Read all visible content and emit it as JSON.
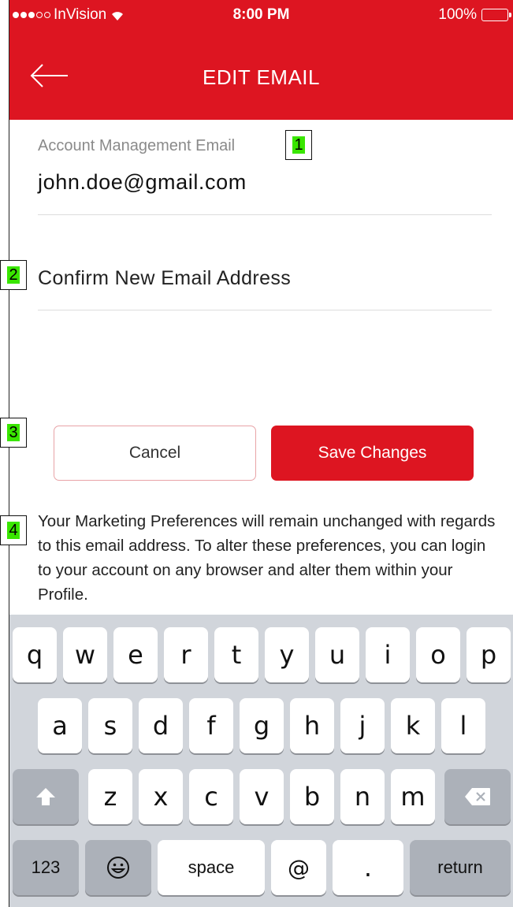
{
  "status_bar": {
    "carrier": "InVision",
    "time": "8:00 PM",
    "battery": "100%"
  },
  "header": {
    "title": "EDIT EMAIL",
    "back_icon": "arrow-left-icon"
  },
  "form": {
    "account_label": "Account Management Email",
    "account_value": "john.doe@gmail.com",
    "confirm_placeholder": "Confirm New Email Address"
  },
  "buttons": {
    "cancel": "Cancel",
    "save": "Save Changes"
  },
  "info_text": "Your Marketing Preferences will remain unchanged with regards to this email address.  To alter these preferences, you can login to your account on any browser and alter them within your Profile.",
  "markers": [
    "1",
    "2",
    "3",
    "4"
  ],
  "keyboard": {
    "row1": [
      "q",
      "w",
      "e",
      "r",
      "t",
      "y",
      "u",
      "i",
      "o",
      "p"
    ],
    "row2": [
      "a",
      "s",
      "d",
      "f",
      "g",
      "h",
      "j",
      "k",
      "l"
    ],
    "row3": [
      "z",
      "x",
      "c",
      "v",
      "b",
      "n",
      "m"
    ],
    "shift_icon": "shift-icon",
    "delete_icon": "delete-icon",
    "numbers": "123",
    "emoji_icon": "emoji-icon",
    "space": "space",
    "at": "@",
    "period": ".",
    "return": "return"
  },
  "colors": {
    "accent": "#dd1521",
    "keyboard_bg": "#d1d5db"
  }
}
